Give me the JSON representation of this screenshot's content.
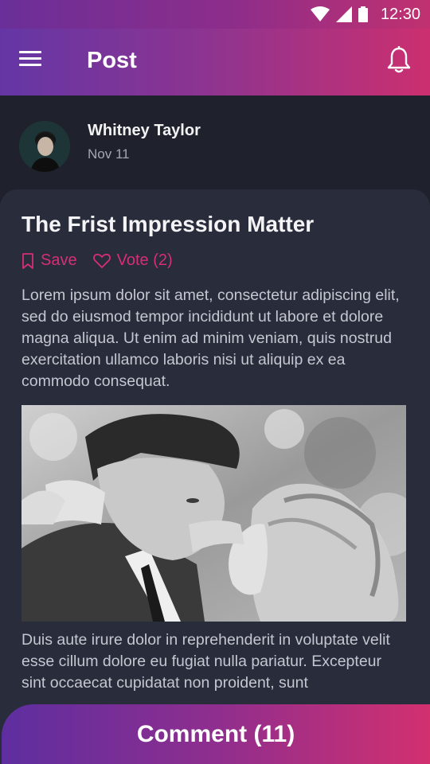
{
  "status_bar": {
    "time": "12:30",
    "icons": [
      "wifi-icon",
      "signal-icon",
      "battery-icon"
    ]
  },
  "app_bar": {
    "title": "Post",
    "menu_icon": "menu-icon",
    "notification_icon": "bell-icon"
  },
  "author": {
    "name": "Whitney Taylor",
    "date": "Nov 11"
  },
  "post": {
    "title": "The Frist Impression Matter",
    "save_label": "Save",
    "vote_label": "Vote (2)",
    "paragraph_1": "Lorem ipsum dolor sit amet, consectetur adipiscing elit, sed do eiusmod tempor incididunt ut labore et dolore magna aliqua. Ut enim ad minim veniam, quis nostrud exercitation ullamco laboris nisi ut aliquip ex ea commodo consequat.",
    "paragraph_2": "Duis aute irure dolor in reprehenderit in voluptate velit esse cillum dolore eu fugiat nulla pariatur. Excepteur sint occaecat cupidatat non proident, sunt"
  },
  "comment_button": {
    "label": "Comment (11)"
  },
  "colors": {
    "accent": "#d62e78",
    "gradient_start": "#6436a5",
    "gradient_end": "#cc2f6f",
    "background": "#1f222c",
    "card": "#282c3b"
  }
}
